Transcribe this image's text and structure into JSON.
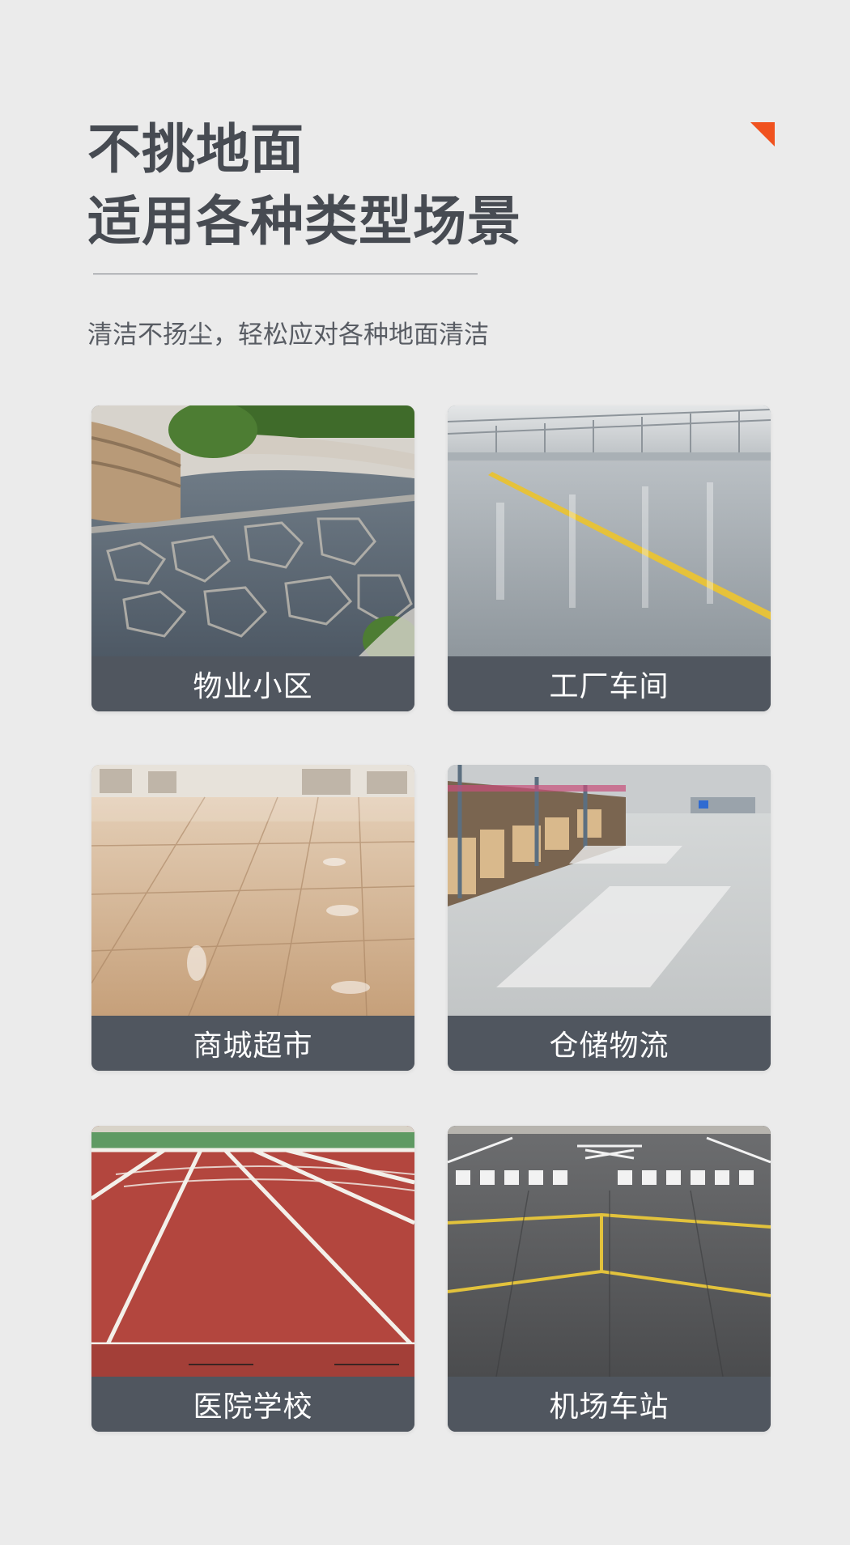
{
  "header": {
    "title_line1": "不挑地面",
    "title_line2": "适用各种类型场景",
    "subtitle": "清洁不扬尘，轻松应对各种地面清洁",
    "accent_color": "#f0521f"
  },
  "cards": [
    {
      "label": "物业小区",
      "image": "stone-paved-courtyard-photo"
    },
    {
      "label": "工厂车间",
      "image": "factory-epoxy-floor-photo"
    },
    {
      "label": "商城超市",
      "image": "mall-tile-floor-photo"
    },
    {
      "label": "仓储物流",
      "image": "warehouse-floor-photo"
    },
    {
      "label": "医院学校",
      "image": "running-track-photo"
    },
    {
      "label": "机场车站",
      "image": "airport-runway-photo"
    }
  ]
}
